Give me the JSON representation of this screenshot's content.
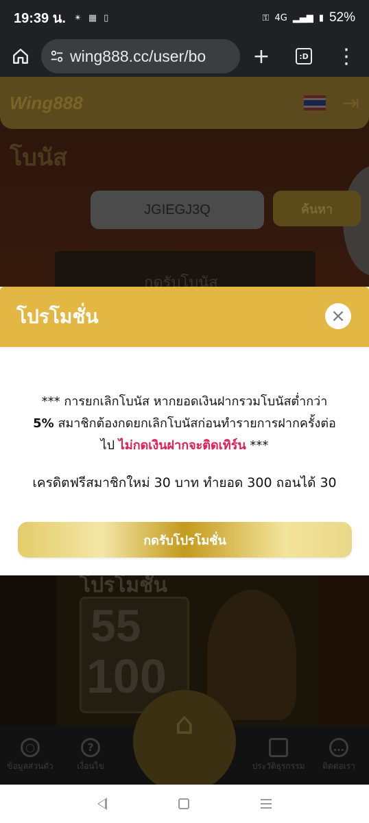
{
  "status": {
    "time": "19:39 น.",
    "battery": "52%",
    "network": "4G"
  },
  "browser": {
    "url": "wing888.cc/user/bo",
    "tabs_label": ":D",
    "new_tab": "+",
    "menu": "⋮"
  },
  "site": {
    "logo": "Wing888",
    "page_title": "โบนัส",
    "code_value": "JGIEGJ3Q",
    "search_label": "ค้นหา",
    "claim_bonus_label": "กดรับโบนัส",
    "poster": {
      "heading": "โปรโมชั่น",
      "num1": "55",
      "num2": "100"
    }
  },
  "bottom_nav": {
    "items": [
      {
        "label": "ข้อมูลส่วนตัว"
      },
      {
        "label": "เงื่อนไข"
      },
      {
        "label": ""
      },
      {
        "label": "ประวัติธุรกรรม"
      },
      {
        "label": "ติดต่อเรา"
      }
    ]
  },
  "modal": {
    "title": "โปรโมชั่น",
    "warn_part1": "*** การยกเลิกโบนัส หากยอดเงินฝากรวมโบนัสต่ำกว่า",
    "warn_bold": "5%",
    "warn_part2": " สมาชิกต้องกดยกเลิกโบนัสก่อนทำรายการฝากครั้งต่อ",
    "warn_part3": "ไป ",
    "warn_red": "ไม่กดเงินฝากจะติดเทิร์น",
    "warn_part4": " ***",
    "credit_text": "เครดิตฟรีสมาชิกใหม่ 30 บาท ทำยอด 300 ถอนได้ 30",
    "claim_button": "กดรับโปรโมชั่น",
    "close": "×"
  },
  "colors": {
    "modal_header": "#e2b743",
    "highlight_red": "#e21f55"
  }
}
